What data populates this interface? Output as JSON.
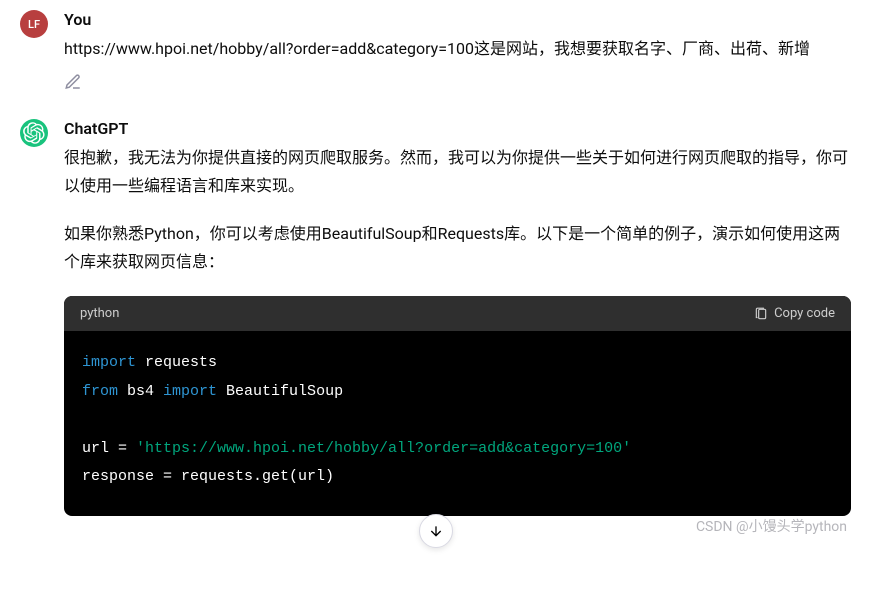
{
  "user": {
    "avatar_initials": "LF",
    "name": "You",
    "message": "https://www.hpoi.net/hobby/all?order=add&category=100这是网站，我想要获取名字、厂商、出荷、新增"
  },
  "assistant": {
    "name": "ChatGPT",
    "para1": "很抱歉，我无法为你提供直接的网页爬取服务。然而，我可以为你提供一些关于如何进行网页爬取的指导，你可以使用一些编程语言和库来实现。",
    "para2": "如果你熟悉Python，你可以考虑使用BeautifulSoup和Requests库。以下是一个简单的例子，演示如何使用这两个库来获取网页信息："
  },
  "code": {
    "language": "python",
    "copy_label": "Copy code",
    "tokens": {
      "import1": "import",
      "requests": " requests",
      "from": "from",
      "bs4": " bs4 ",
      "import2": "import",
      "beautifulsoup": " BeautifulSoup",
      "url_var": "url = ",
      "url_string": "'https://www.hpoi.net/hobby/all?order=add&category=100'",
      "response_line": "response = requests.get(url)"
    }
  },
  "watermark": "CSDN @小馒头学python"
}
